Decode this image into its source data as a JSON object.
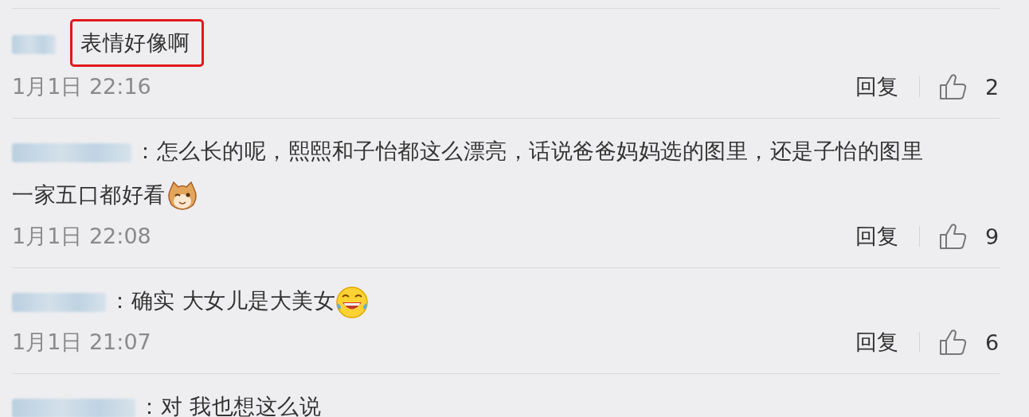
{
  "comments": [
    {
      "highlighted": true,
      "content": [
        {
          "kind": "text",
          "text": "表情好像啊"
        }
      ],
      "time": "1月1日 22:16",
      "reply": "回复",
      "likes": "2"
    },
    {
      "separator": "：",
      "highlighted": false,
      "content": [
        {
          "kind": "text",
          "text": "怎么长的呢，熙熙和子怡都这么漂亮，话说爸爸妈妈选的图里，还是子怡的图里"
        },
        {
          "kind": "line",
          "text": "一家五口都好看"
        },
        {
          "kind": "hamster"
        }
      ],
      "time": "1月1日 22:08",
      "reply": "回复",
      "likes": "9"
    },
    {
      "separator": "：",
      "highlighted": false,
      "content": [
        {
          "kind": "text",
          "text": "确实  大女儿是大美女"
        },
        {
          "kind": "laughing"
        }
      ],
      "time": "1月1日 21:07",
      "reply": "回复",
      "likes": "6"
    },
    {
      "separator": "：",
      "highlighted": false,
      "content": [
        {
          "kind": "text",
          "text": "对 我也想这么说"
        }
      ]
    }
  ]
}
